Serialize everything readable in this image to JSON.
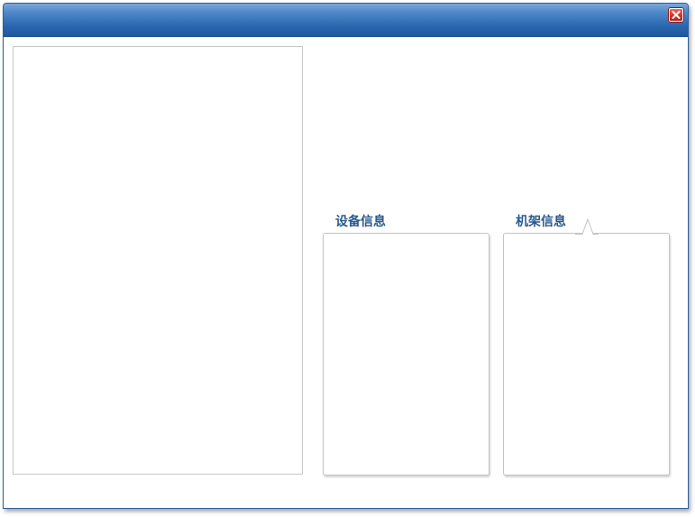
{
  "device_info": {
    "label": "设备信息"
  },
  "rack_info": {
    "label": "机架信息"
  },
  "icons": {
    "close": "close-icon",
    "pointer": "callout-pointer-icon"
  },
  "colors": {
    "titlebar": "#2a66ae",
    "label": "#2a5a8e",
    "close": "#d9382a"
  }
}
